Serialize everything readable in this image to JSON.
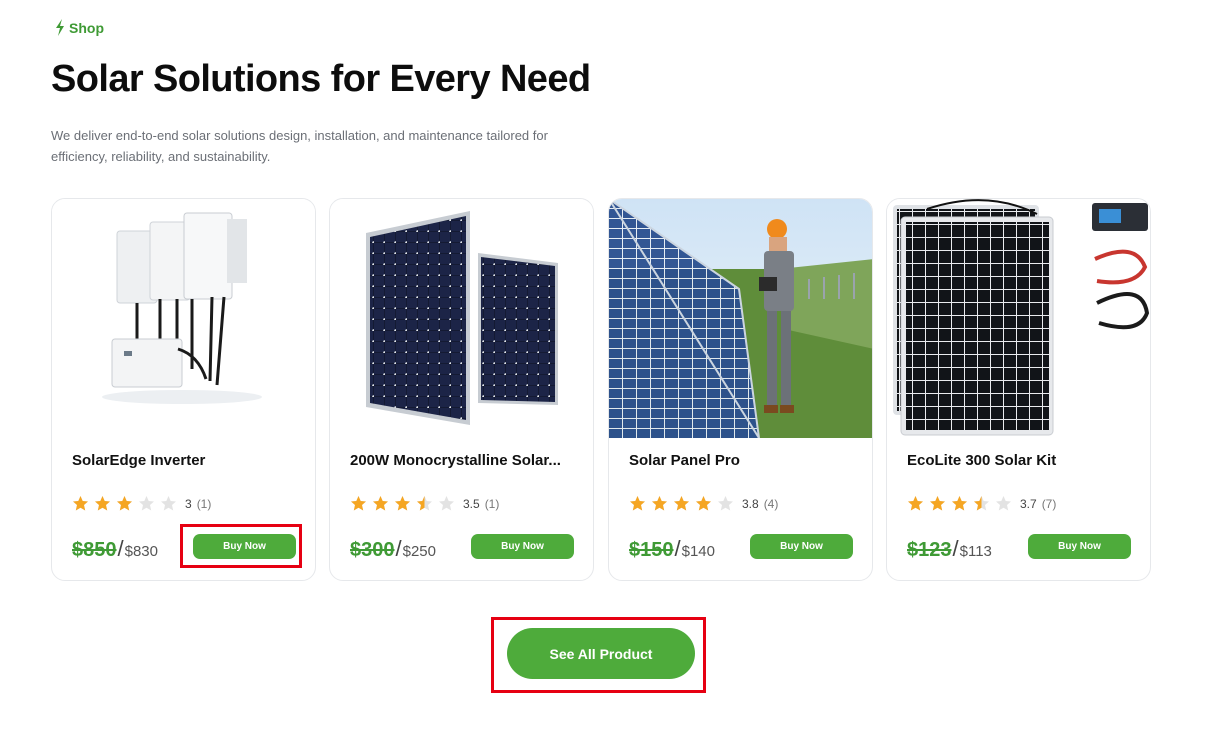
{
  "section": {
    "eyebrow": "Shop",
    "title": "Solar Solutions for Every Need",
    "description": "We deliver end-to-end solar solutions design, installation, and maintenance tailored for efficiency, reliability, and sustainability."
  },
  "products": [
    {
      "name": "SolarEdge Inverter",
      "rating": 3,
      "rating_text": "3",
      "reviews": "(1)",
      "old_price": "$850",
      "sep": "/",
      "new_price": "$830",
      "buy_label": "Buy Now"
    },
    {
      "name": "200W Monocrystalline Solar...",
      "rating": 3.5,
      "rating_text": "3.5",
      "reviews": "(1)",
      "old_price": "$300",
      "sep": "/",
      "new_price": "$250",
      "buy_label": "Buy Now"
    },
    {
      "name": "Solar Panel Pro",
      "rating": 3.8,
      "rating_text": "3.8",
      "reviews": "(4)",
      "old_price": "$150",
      "sep": "/",
      "new_price": "$140",
      "buy_label": "Buy Now"
    },
    {
      "name": "EcoLite 300 Solar Kit",
      "rating": 3.7,
      "rating_text": "3.7",
      "reviews": "(7)",
      "old_price": "$123",
      "sep": "/",
      "new_price": "$113",
      "buy_label": "Buy Now"
    }
  ],
  "cta": {
    "label": "See All Product"
  },
  "colors": {
    "accent": "#4eab3b",
    "star": "#f5a623",
    "star_empty": "#e3e3e3",
    "highlight": "#e60012"
  }
}
